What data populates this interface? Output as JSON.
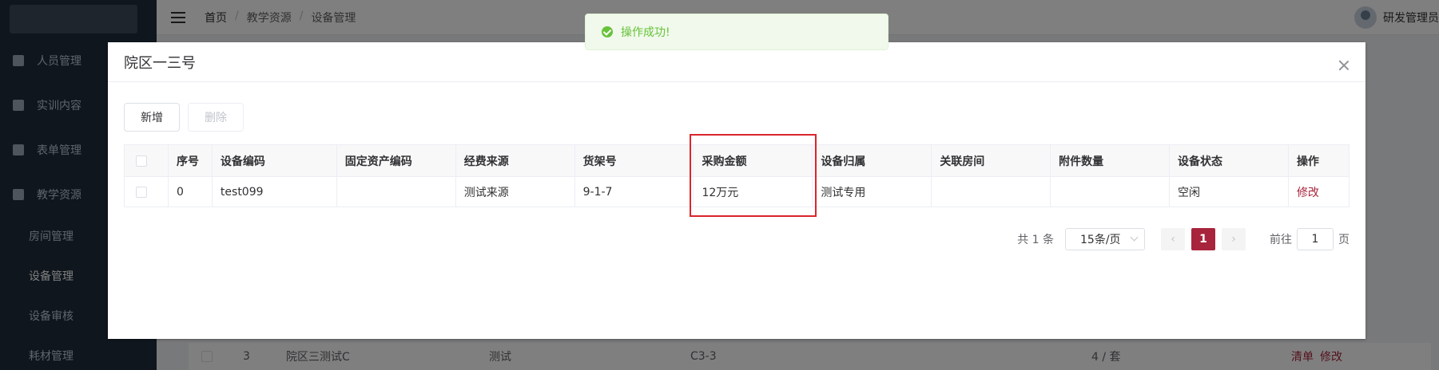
{
  "sidebar": {
    "menu": [
      {
        "label": "人员管理",
        "icon": "user-icon"
      },
      {
        "label": "实训内容",
        "icon": "book-icon"
      },
      {
        "label": "表单管理",
        "icon": "form-icon"
      },
      {
        "label": "教学资源",
        "icon": "resource-icon"
      }
    ],
    "submenu": [
      {
        "label": "房间管理"
      },
      {
        "label": "设备管理"
      },
      {
        "label": "设备审核"
      },
      {
        "label": "耗材管理"
      }
    ]
  },
  "header": {
    "breadcrumb": [
      "首页",
      "教学资源",
      "设备管理"
    ],
    "user_name": "研发管理员"
  },
  "background_row": {
    "index": "3",
    "name": "院区三测试C",
    "source": "测试",
    "shelf": "C3-3",
    "count": "4 / 套",
    "action_list": "清单",
    "action_edit": "修改"
  },
  "toast": {
    "message": "操作成功!",
    "type": "success"
  },
  "dialog": {
    "title": "院区一三号",
    "add_button": "新增",
    "delete_button": "删除",
    "columns": [
      "序号",
      "设备编码",
      "固定资产编码",
      "经费来源",
      "货架号",
      "采购金额",
      "设备归属",
      "关联房间",
      "附件数量",
      "设备状态",
      "操作"
    ],
    "rows": [
      {
        "index": "0",
        "code": "test099",
        "asset_code": "",
        "fund_source": "测试来源",
        "shelf": "9-1-7",
        "amount": "12万元",
        "owner": "测试专用",
        "room": "",
        "attachments": "",
        "status": "空闲",
        "action": "修改"
      }
    ],
    "pagination": {
      "total": "共 1 条",
      "page_size": "15条/页",
      "current_page": "1",
      "goto_prefix": "前往",
      "goto_value": "1",
      "goto_suffix": "页"
    }
  },
  "colors": {
    "accent": "#a8243c",
    "success": "#67c23a",
    "highlight": "#d9262c"
  }
}
